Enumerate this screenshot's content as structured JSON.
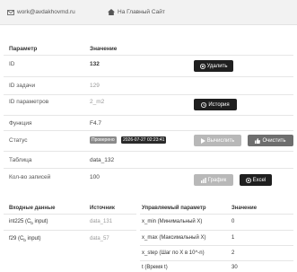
{
  "topbar": {
    "email": "work@avdakhovmd.ru",
    "home_link": "На Главный Сайт"
  },
  "details": {
    "header_param": "Параметр",
    "header_value": "Значение",
    "rows": [
      {
        "label": "ID",
        "value": "132"
      },
      {
        "label": "ID задачи",
        "value": "129"
      },
      {
        "label": "ID параметров",
        "value": "2_m2"
      },
      {
        "label": "Функция",
        "value": "F4.7"
      },
      {
        "label": "Статус",
        "value": ""
      },
      {
        "label": "Таблица",
        "value": "data_132"
      },
      {
        "label": "Кол-во записей",
        "value": "100"
      }
    ],
    "status_badge": "Проверено",
    "status_time": "2026-07-27 02:23:41"
  },
  "buttons": {
    "delete": "Удалить",
    "history": "История",
    "compute": "Вычислить",
    "clear": "Очистить",
    "graph": "График",
    "excel": "Excel"
  },
  "inputs_table": {
    "headers": [
      "Входные данные",
      "Источник"
    ],
    "rows": [
      {
        "name_pre": "int225 (C",
        "name_sub": "b",
        "name_post": " input)",
        "source": "data_131"
      },
      {
        "name_pre": "f29 (C",
        "name_sub": "b",
        "name_post": " input)",
        "source": "data_57"
      }
    ]
  },
  "controls_table": {
    "headers": [
      "Управляемый параметр",
      "Значение"
    ],
    "rows": [
      {
        "name": "x_min (Минимальный X)",
        "value": "0"
      },
      {
        "name": "x_max (Максимальный X)",
        "value": "1"
      },
      {
        "name": "x_step (Шаг по X в 10^-n)",
        "value": "2"
      },
      {
        "name": "t (Время t)",
        "value": "30"
      }
    ]
  }
}
